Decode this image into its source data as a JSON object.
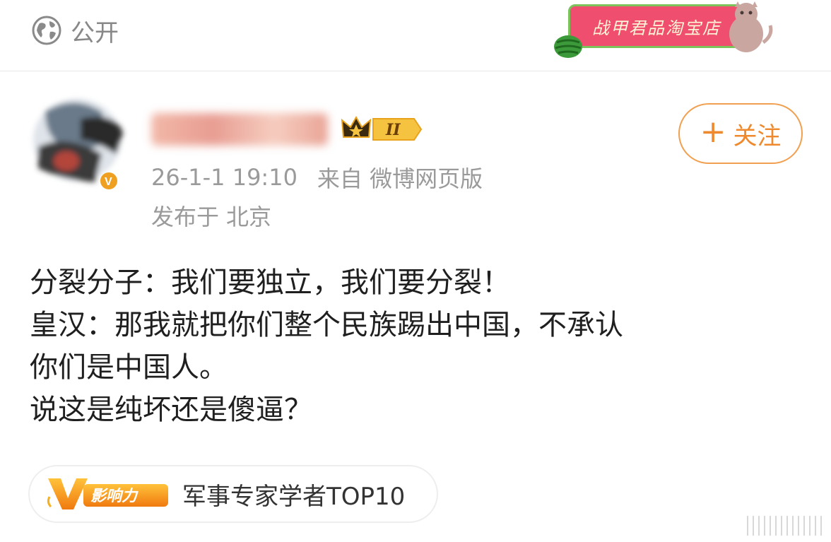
{
  "header": {
    "visibility_label": "公开",
    "shop_label": "战甲君品淘宝店"
  },
  "author": {
    "badge_level": "II",
    "follow_label": "关注",
    "timestamp": "26-1-1 19:10",
    "source": "来自 微博网页版",
    "location_prefix": "发布于",
    "location": "北京"
  },
  "post": {
    "lines": [
      "分裂分子：我们要独立，我们要分裂！",
      "皇汉：那我就把你们整个民族踢出中国，不承认",
      "你们是中国人。",
      "说这是纯坏还是傻逼？"
    ]
  },
  "influence": {
    "logo_text": "影响力",
    "tag_text": "军事专家学者TOP10"
  },
  "colors": {
    "accent_orange": "#ee8a2d",
    "shop_pink": "#f04e6e",
    "meta_gray": "#9a9a9a"
  }
}
